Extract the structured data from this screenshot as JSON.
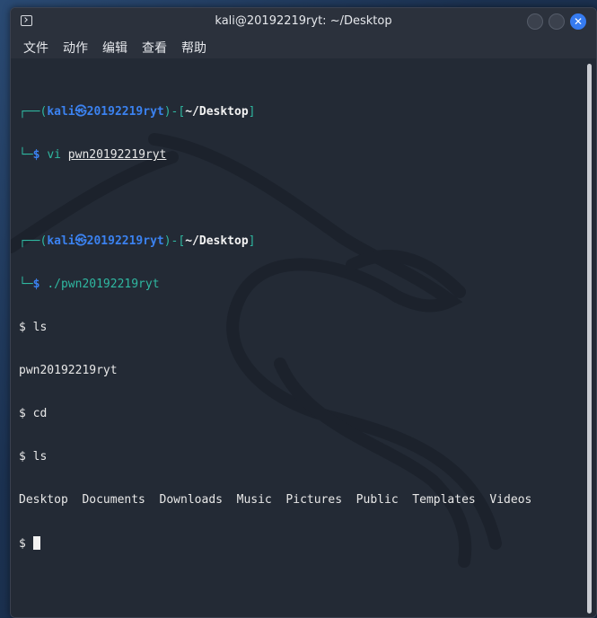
{
  "window": {
    "title": "kali@20192219ryt: ~/Desktop"
  },
  "menu": [
    "文件",
    "动作",
    "编辑",
    "查看",
    "帮助"
  ],
  "prompts": [
    {
      "user": "kali",
      "at": "㉿",
      "host": "20192219ryt",
      "path": "~/Desktop",
      "symbol": "$",
      "command": "vi",
      "arg": "pwn20192219ryt"
    },
    {
      "user": "kali",
      "at": "㉿",
      "host": "20192219ryt",
      "path": "~/Desktop",
      "symbol": "$",
      "command": "./pwn20192219ryt"
    }
  ],
  "output": {
    "line1": "$ ls",
    "line2": "pwn20192219ryt",
    "line3": "$ cd",
    "line4": "$ ls",
    "line5": "Desktop  Documents  Downloads  Music  Pictures  Public  Templates  Videos",
    "line6": "$ "
  },
  "colors": {
    "prompt_green": "#2fb8a1",
    "prompt_blue": "#3b82f0",
    "close_button": "#367bf0",
    "terminal_bg": "#232a35"
  }
}
